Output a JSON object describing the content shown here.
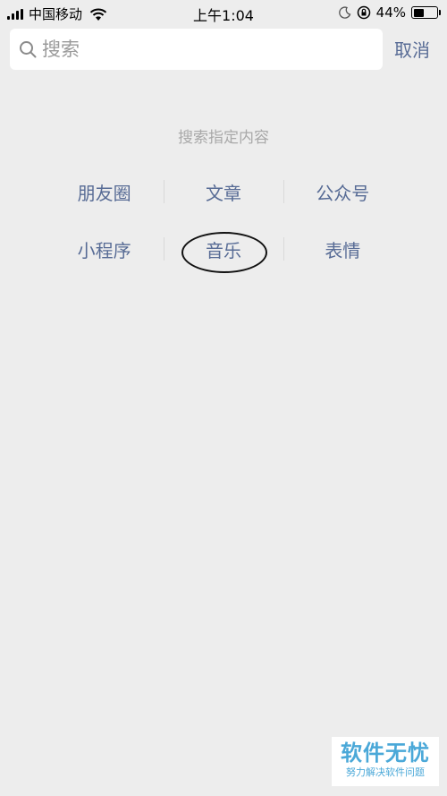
{
  "status_bar": {
    "carrier": "中国移动",
    "time": "上午1:04",
    "battery_percent": "44%",
    "battery_level": 0.44,
    "icons": [
      "signal-icon",
      "wifi-icon",
      "moon-icon",
      "rotation-lock-icon",
      "battery-icon"
    ]
  },
  "search": {
    "placeholder": "搜索",
    "cancel_label": "取消"
  },
  "hint": "搜索指定内容",
  "categories": [
    [
      "朋友圈",
      "文章",
      "公众号"
    ],
    [
      "小程序",
      "音乐",
      "表情"
    ]
  ],
  "watermark": {
    "title": "软件无忧",
    "subtitle": "努力解决软件问题"
  },
  "colors": {
    "background": "#ededed",
    "link": "#576b95",
    "hint": "#a9a9a9",
    "watermark": "#4aa8d8"
  }
}
